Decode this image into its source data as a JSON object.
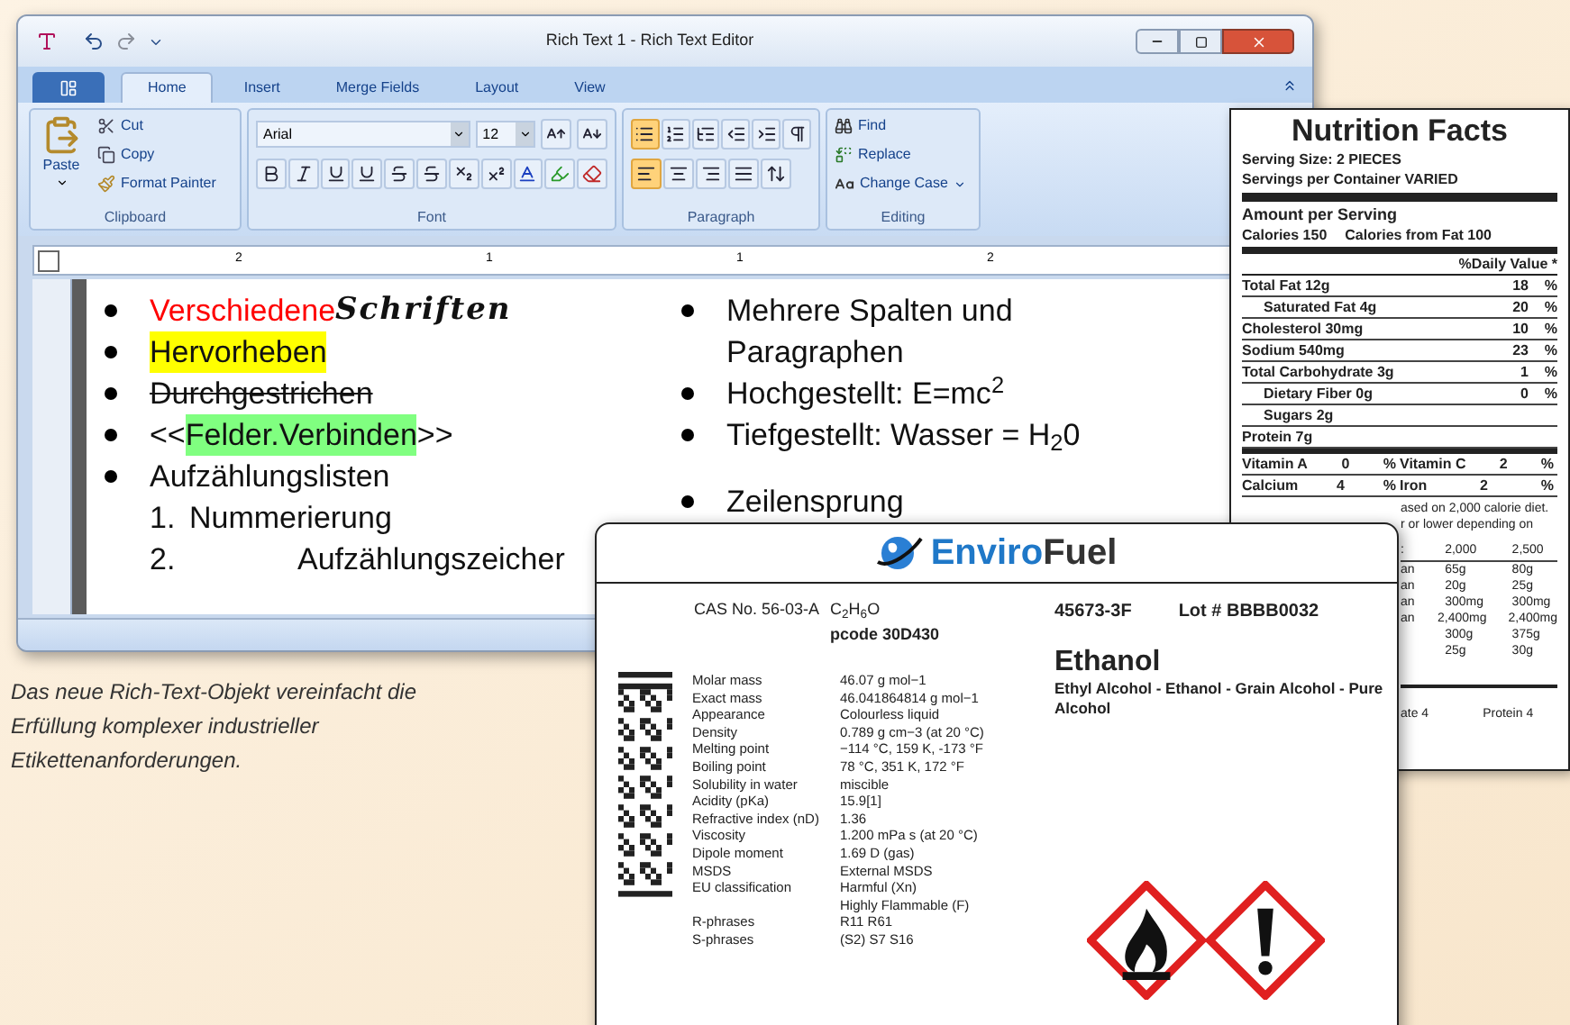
{
  "editor": {
    "title": "Rich Text 1 - Rich Text Editor",
    "tabs": [
      {
        "label": "Home",
        "selected": true
      },
      {
        "label": "Insert",
        "selected": false
      },
      {
        "label": "Merge Fields",
        "selected": false
      },
      {
        "label": "Layout",
        "selected": false
      },
      {
        "label": "View",
        "selected": false
      }
    ],
    "clipboard": {
      "paste": "Paste",
      "cut": "Cut",
      "copy": "Copy",
      "format_painter": "Format Painter",
      "label": "Clipboard"
    },
    "font": {
      "name": "Arial",
      "size": "12",
      "label": "Font"
    },
    "paragraph": {
      "label": "Paragraph",
      "bullets_on": true,
      "align": [
        {
          "selected": true
        },
        {
          "selected": false
        },
        {
          "selected": false
        },
        {
          "selected": false
        }
      ]
    },
    "editing": {
      "find": "Find",
      "replace": "Replace",
      "change_case": "Change Case",
      "label": "Editing"
    },
    "ruler_numbers": [
      "2",
      "1",
      "1",
      "2"
    ],
    "left_column": [
      {
        "kind": "fonts",
        "text": "Verschiedene",
        "text_2": "Schriften",
        "color": "#ff0000"
      },
      {
        "kind": "highlight",
        "text": "Hervorheben",
        "color": "#ffff00"
      },
      {
        "kind": "strike",
        "text": "Durchgestrichen"
      },
      {
        "kind": "merge",
        "prefix": "<<",
        "text": "Felder.Verbinden",
        "suffix": ">>",
        "color": "#80ff80"
      },
      {
        "kind": "bullet",
        "text": "Aufzählungslisten"
      },
      {
        "kind": "numbered",
        "number": "1.",
        "text": "Nummerierung"
      },
      {
        "kind": "numbered_wide",
        "number": "2.",
        "text": "Aufzählungszeicher"
      }
    ],
    "right_column": [
      {
        "kind": "bullet",
        "text": "Mehrere Spalten und"
      },
      {
        "kind": "continued",
        "text": "Paragraphen"
      },
      {
        "kind": "bullet",
        "text": "Hochgestellt: E=mc$^{2}$"
      },
      {
        "kind": "bullet",
        "text": "Tiefgestellt: Wasser = H$_{2}$0"
      },
      {
        "kind": "gap"
      },
      {
        "kind": "bullet",
        "text": "Zeilensprung"
      }
    ]
  },
  "caption": "Das neue Rich-Text-Objekt vereinfacht die Erfüllung komplexer industrieller Etikettenanforderungen.",
  "nutrition": {
    "title": "Nutrition Facts",
    "serving_size": "Serving Size:  2 PIECES",
    "servings": "Servings per Container   VARIED",
    "amount_per_serving": "Amount per Serving",
    "calories": "Calories  150",
    "calories_fat": "Calories from Fat  100",
    "daily_value": "%Daily Value *",
    "rows": [
      {
        "kind": "main",
        "label": "Total Fat  12g",
        "dv": "18",
        "unit": "%"
      },
      {
        "kind": "sub",
        "label": "Saturated Fat  4g",
        "dv": "20",
        "unit": "%"
      },
      {
        "kind": "main",
        "label": "Cholesterol  30mg",
        "dv": "10",
        "unit": "%"
      },
      {
        "kind": "main",
        "label": "Sodium  540mg",
        "dv": "23",
        "unit": "%"
      },
      {
        "kind": "main",
        "label": "Total Carbohydrate  3g",
        "dv": "1",
        "unit": "%"
      },
      {
        "kind": "sub",
        "label": "Dietary Fiber  0g",
        "dv": "0",
        "unit": "%"
      },
      {
        "kind": "sub",
        "label": "Sugars  2g"
      },
      {
        "kind": "main",
        "label": "Protein  7g"
      }
    ],
    "vitamins": [
      [
        {
          "name": "Vitamin A",
          "value": "0",
          "unit": "%"
        },
        {
          "name": "Vitamin C",
          "value": "2",
          "unit": "%"
        }
      ],
      [
        {
          "name": "Calcium",
          "value": "4",
          "unit": "%"
        },
        {
          "name": "Iron",
          "value": "2",
          "unit": "%"
        }
      ]
    ],
    "footnote": [
      "ased on 2,000 calorie diet.",
      "r or lower depending on"
    ],
    "table_header": [
      ":",
      "2,000",
      "2,500"
    ],
    "table_rows": [
      [
        "an",
        "65g",
        "80g"
      ],
      [
        "an",
        "20g",
        "25g"
      ],
      [
        "an",
        "300mg",
        "300mg"
      ],
      [
        "an",
        "2,400mg",
        "2,400mg"
      ],
      [
        "",
        "300g",
        "375g"
      ],
      [
        "",
        "25g",
        "30g"
      ]
    ],
    "bottom": [
      "ate 4",
      "Protein 4"
    ]
  },
  "label": {
    "logo_1": "Enviro",
    "logo_2": "Fuel",
    "cas": "CAS No. 56-03-A",
    "formula": "C$_{2}$H$_{6}$O",
    "pcode": "pcode 30D430",
    "code": "45673-3F",
    "lot": "Lot # BBBB0032",
    "name": "Ethanol",
    "synonyms": "Ethyl Alcohol - Ethanol - Grain Alcohol - Pure Alcohol",
    "properties": [
      {
        "name": "Molar mass",
        "value": "46.07 g mol−1"
      },
      {
        "name": "Exact mass",
        "value": "46.041864814 g mol−1"
      },
      {
        "name": "Appearance",
        "value": "Colourless liquid"
      },
      {
        "name": "Density",
        "value": "0.789 g cm−3 (at 20 °C)"
      },
      {
        "name": "Melting point",
        "value": "−114 °C, 159 K, -173 °F"
      },
      {
        "name": "Boiling point",
        "value": "78 °C, 351 K, 172 °F"
      },
      {
        "name": "Solubility in water",
        "value": "miscible"
      },
      {
        "name": "Acidity (pKa)",
        "value": "15.9[1]"
      },
      {
        "name": "Refractive index (nD)",
        "value": "1.36"
      },
      {
        "name": "Viscosity",
        "value": "1.200 mPa s (at 20 °C)"
      },
      {
        "name": "Dipole moment",
        "value": "1.69 D (gas)"
      },
      {
        "name": "MSDS",
        "value": "External MSDS"
      },
      {
        "name": "EU classification",
        "value": "Harmful (Xn)"
      },
      {
        "value": "Highly Flammable (F)"
      },
      {
        "name": "R-phrases",
        "value": "R11 R61"
      },
      {
        "name": "S-phrases",
        "value": "(S2) S7 S16"
      }
    ],
    "pictograms": [
      {
        "kind": "flame"
      },
      {
        "kind": "exclamation"
      }
    ]
  }
}
